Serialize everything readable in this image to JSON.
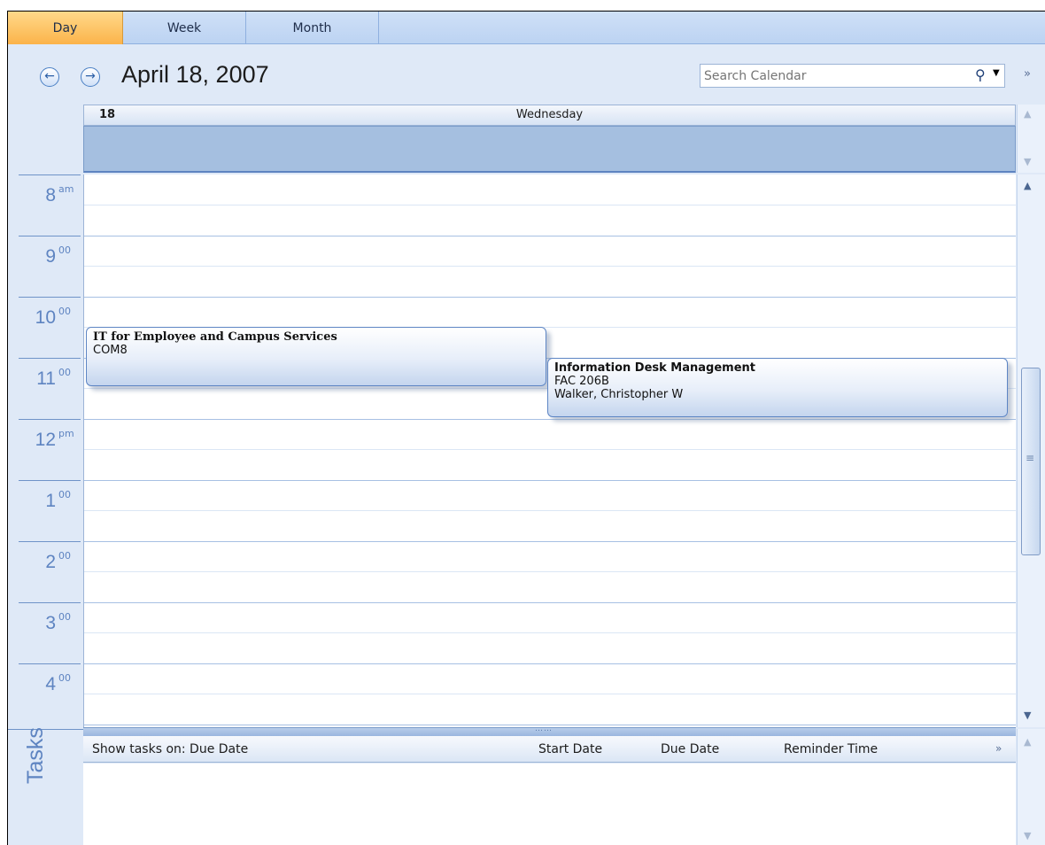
{
  "tabs": [
    {
      "label": "Day",
      "active": true
    },
    {
      "label": "Week",
      "active": false
    },
    {
      "label": "Month",
      "active": false
    }
  ],
  "header": {
    "date_title": "April 18, 2007",
    "search_placeholder": "Search Calendar",
    "icons": {
      "back": "arrow-left-icon",
      "forward": "arrow-right-icon",
      "search": "search-icon",
      "expand": "double-chevron-down-icon"
    }
  },
  "day_view": {
    "day_number": "18",
    "day_name": "Wednesday",
    "hours": [
      {
        "label": "8",
        "suffix": "am"
      },
      {
        "label": "9",
        "suffix": "00"
      },
      {
        "label": "10",
        "suffix": "00"
      },
      {
        "label": "11",
        "suffix": "00"
      },
      {
        "label": "12",
        "suffix": "pm"
      },
      {
        "label": "1",
        "suffix": "00"
      },
      {
        "label": "2",
        "suffix": "00"
      },
      {
        "label": "3",
        "suffix": "00"
      },
      {
        "label": "4",
        "suffix": "00"
      }
    ],
    "appointments": [
      {
        "title": "IT for Employee and Campus Services",
        "location": "COM8",
        "organizer": ""
      },
      {
        "title": "Information Desk Management",
        "location": "FAC 206B",
        "organizer": "Walker, Christopher W"
      }
    ]
  },
  "tasks": {
    "label": "Tasks",
    "show_label": "Show tasks on: Due Date",
    "columns": [
      "Start Date",
      "Due Date",
      "Reminder Time"
    ]
  },
  "colors": {
    "accent_active_tab": "#fbb34a",
    "ruler_text": "#5e84c1",
    "allday_band": "#a5bfe0",
    "appointment_border": "#5d85c4"
  }
}
